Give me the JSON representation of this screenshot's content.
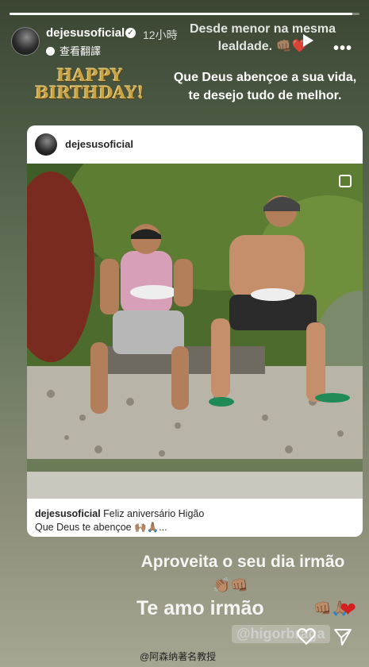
{
  "story": {
    "username": "dejesusoficial",
    "time": "12小時",
    "translate_label": "查看翻譯",
    "progress": 0.98,
    "top_text": "Desde menor na mesma lealdade.",
    "top_emoji": "👊🏽❤️",
    "birthday_sticker": "HAPPY BIRTHDAY!",
    "blessing": "Que Deus abençoe a sua vida, te desejo tudo de melhor."
  },
  "post": {
    "username": "dejesusoficial",
    "caption_user": "dejesusoficial",
    "caption_line1": "Feliz aniversário Higão",
    "caption_line2": "Que Deus te abençoe 🙌🏽🙏🏽..."
  },
  "overlay": {
    "line1": "Aproveita o seu dia irmão",
    "line1_emoji": "👏🏽👊🏽",
    "line2": "Te amo irmão",
    "line2_emoji": "👊🏽🙏🏽",
    "heart": "❤",
    "mention": "@higorbraga"
  },
  "watermark": "@阿森纳著名教授",
  "icons": [
    "verified-icon",
    "play-icon",
    "more-icon",
    "like-icon",
    "send-icon",
    "multi-photo-icon"
  ]
}
